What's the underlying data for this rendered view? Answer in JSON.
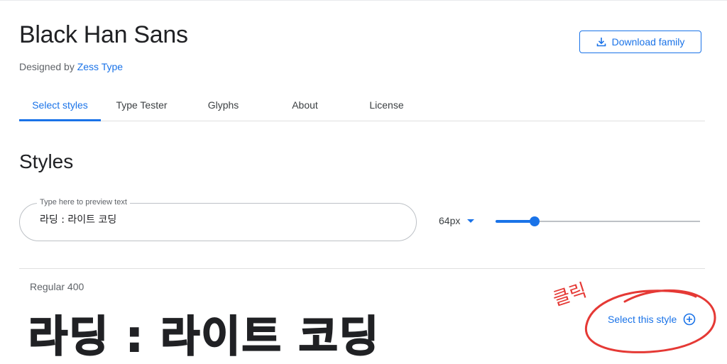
{
  "header": {
    "font_title": "Black Han Sans",
    "designed_by_prefix": "Designed by",
    "designer_name": "Zess Type",
    "download_label": "Download family",
    "download_icon": "download-icon"
  },
  "tabs": [
    {
      "label": "Select styles",
      "active": true
    },
    {
      "label": "Type Tester",
      "active": false
    },
    {
      "label": "Glyphs",
      "active": false
    },
    {
      "label": "About",
      "active": false
    },
    {
      "label": "License",
      "active": false
    }
  ],
  "styles_section": {
    "heading": "Styles",
    "preview_label": "Type here to preview text",
    "preview_value": "라딩 : 라이트 코딩",
    "size_value": "64px",
    "slider_fraction": 0.19
  },
  "style_rows": [
    {
      "name": "Regular 400",
      "preview_text": "라딩 : 라이트 코딩",
      "select_label": "Select this style",
      "select_icon": "plus-circle-icon"
    }
  ],
  "annotation": {
    "text": "클릭",
    "color": "#e53935"
  },
  "colors": {
    "accent": "#1a73e8",
    "text_primary": "#202124",
    "text_secondary": "#5f6368",
    "divider": "#e0e0e0"
  }
}
